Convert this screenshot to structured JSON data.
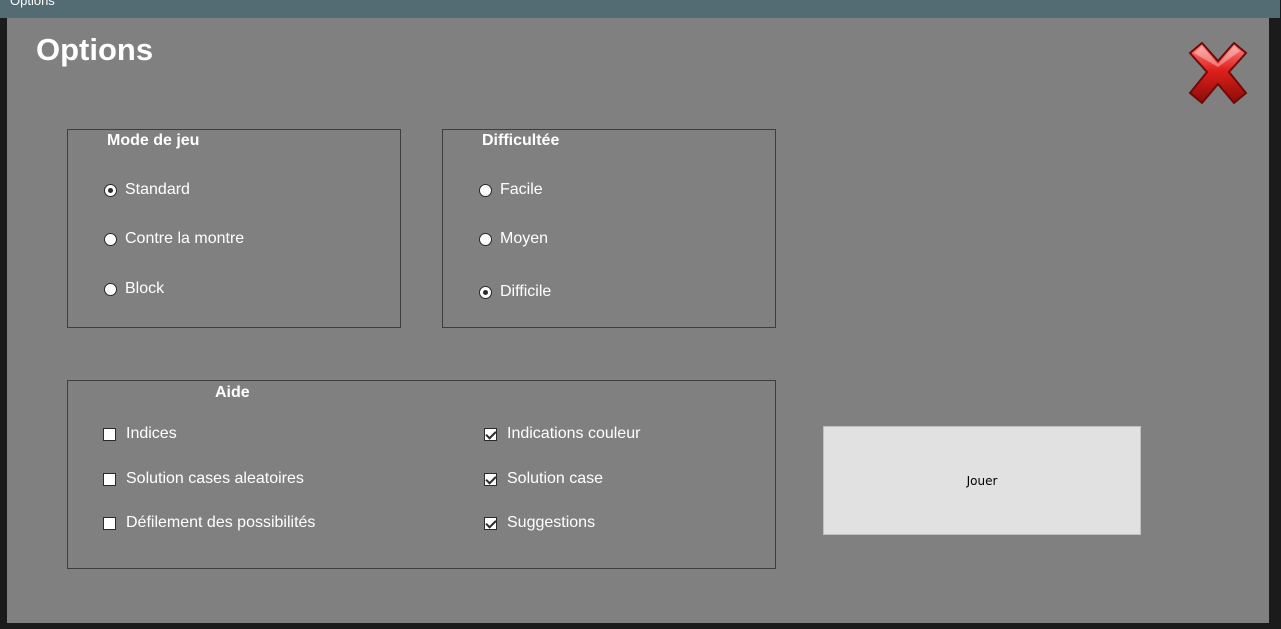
{
  "window": {
    "title": "Options"
  },
  "page": {
    "heading": "Options"
  },
  "close_button": {
    "icon": "close-x-icon",
    "color": "#e0201b"
  },
  "game_mode": {
    "title": "Mode de jeu",
    "options": [
      {
        "label": "Standard",
        "selected": true
      },
      {
        "label": "Contre la montre",
        "selected": false
      },
      {
        "label": "Block",
        "selected": false
      }
    ]
  },
  "difficulty": {
    "title": "Difficultée",
    "options": [
      {
        "label": "Facile",
        "selected": false
      },
      {
        "label": "Moyen",
        "selected": false
      },
      {
        "label": "Difficile",
        "selected": true
      }
    ]
  },
  "help": {
    "title": "Aide",
    "options": [
      {
        "label": "Indices",
        "checked": false
      },
      {
        "label": "Solution cases aleatoires",
        "checked": false
      },
      {
        "label": "Défilement des possibilités",
        "checked": false
      },
      {
        "label": "Indications couleur",
        "checked": true
      },
      {
        "label": "Solution case",
        "checked": true
      },
      {
        "label": "Suggestions",
        "checked": true
      }
    ]
  },
  "play_button": {
    "label": "Jouer"
  },
  "colors": {
    "titlebar": "#536b72",
    "background": "#808080",
    "button": "#e1e1e1"
  }
}
